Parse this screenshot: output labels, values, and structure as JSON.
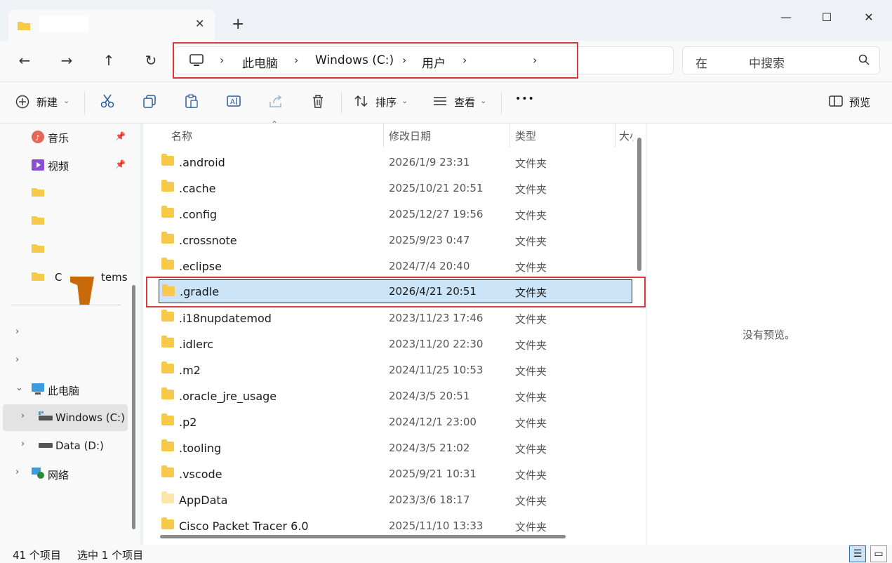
{
  "window": {
    "tab_close": "✕",
    "new_tab": "+",
    "minimize": "—",
    "maximize": "☐",
    "close": "✕"
  },
  "nav": {
    "back": "←",
    "forward": "→",
    "up": "↑",
    "refresh": "↻",
    "breadcrumb": [
      "此电脑",
      "Windows (C:)",
      "用户"
    ],
    "search_placeholder_a": "在",
    "search_placeholder_b": "中搜索"
  },
  "toolbar": {
    "new_label": "新建",
    "sort_label": "排序",
    "view_label": "查看",
    "more": "•••",
    "preview_label": "预览"
  },
  "sidebar": {
    "pinned": [
      {
        "label": "音乐",
        "icon": "music-icon"
      },
      {
        "label": "视频",
        "icon": "video-icon"
      }
    ],
    "partial_label": "C",
    "partial_label2": "tems",
    "this_pc": "此电脑",
    "drives": [
      {
        "label": "Windows (C:)",
        "icon": "drive-icon"
      },
      {
        "label": "Data (D:)",
        "icon": "drive-icon"
      }
    ],
    "network": "网络"
  },
  "columns": {
    "name": "名称",
    "date": "修改日期",
    "type": "类型",
    "size": "大小"
  },
  "files": [
    {
      "name": ".android",
      "date": "2026/1/9 23:31",
      "type": "文件夹"
    },
    {
      "name": ".cache",
      "date": "2025/10/21 20:51",
      "type": "文件夹"
    },
    {
      "name": ".config",
      "date": "2025/12/27 19:56",
      "type": "文件夹"
    },
    {
      "name": ".crossnote",
      "date": "2025/9/23 0:47",
      "type": "文件夹"
    },
    {
      "name": ".eclipse",
      "date": "2024/7/4 20:40",
      "type": "文件夹"
    },
    {
      "name": ".gradle",
      "date": "2026/4/21 20:51",
      "type": "文件夹"
    },
    {
      "name": ".i18nupdatemod",
      "date": "2023/11/23 17:46",
      "type": "文件夹"
    },
    {
      "name": ".idlerc",
      "date": "2023/11/20 22:30",
      "type": "文件夹"
    },
    {
      "name": ".m2",
      "date": "2024/11/25 10:53",
      "type": "文件夹"
    },
    {
      "name": ".oracle_jre_usage",
      "date": "2024/3/5 20:51",
      "type": "文件夹"
    },
    {
      "name": ".p2",
      "date": "2024/12/1 23:00",
      "type": "文件夹"
    },
    {
      "name": ".tooling",
      "date": "2024/3/5 21:02",
      "type": "文件夹"
    },
    {
      "name": ".vscode",
      "date": "2025/9/21 10:31",
      "type": "文件夹"
    },
    {
      "name": "AppData",
      "date": "2023/3/6 18:17",
      "type": "文件夹"
    },
    {
      "name": "Cisco Packet Tracer 6.0",
      "date": "2025/11/10 13:33",
      "type": "文件夹"
    }
  ],
  "preview": {
    "message": "没有预览。"
  },
  "status": {
    "item_count": "41 个项目",
    "selected": "选中 1 个项目"
  },
  "colors": {
    "highlight_red": "#d9383a",
    "selection_blue": "#cce4f7"
  }
}
